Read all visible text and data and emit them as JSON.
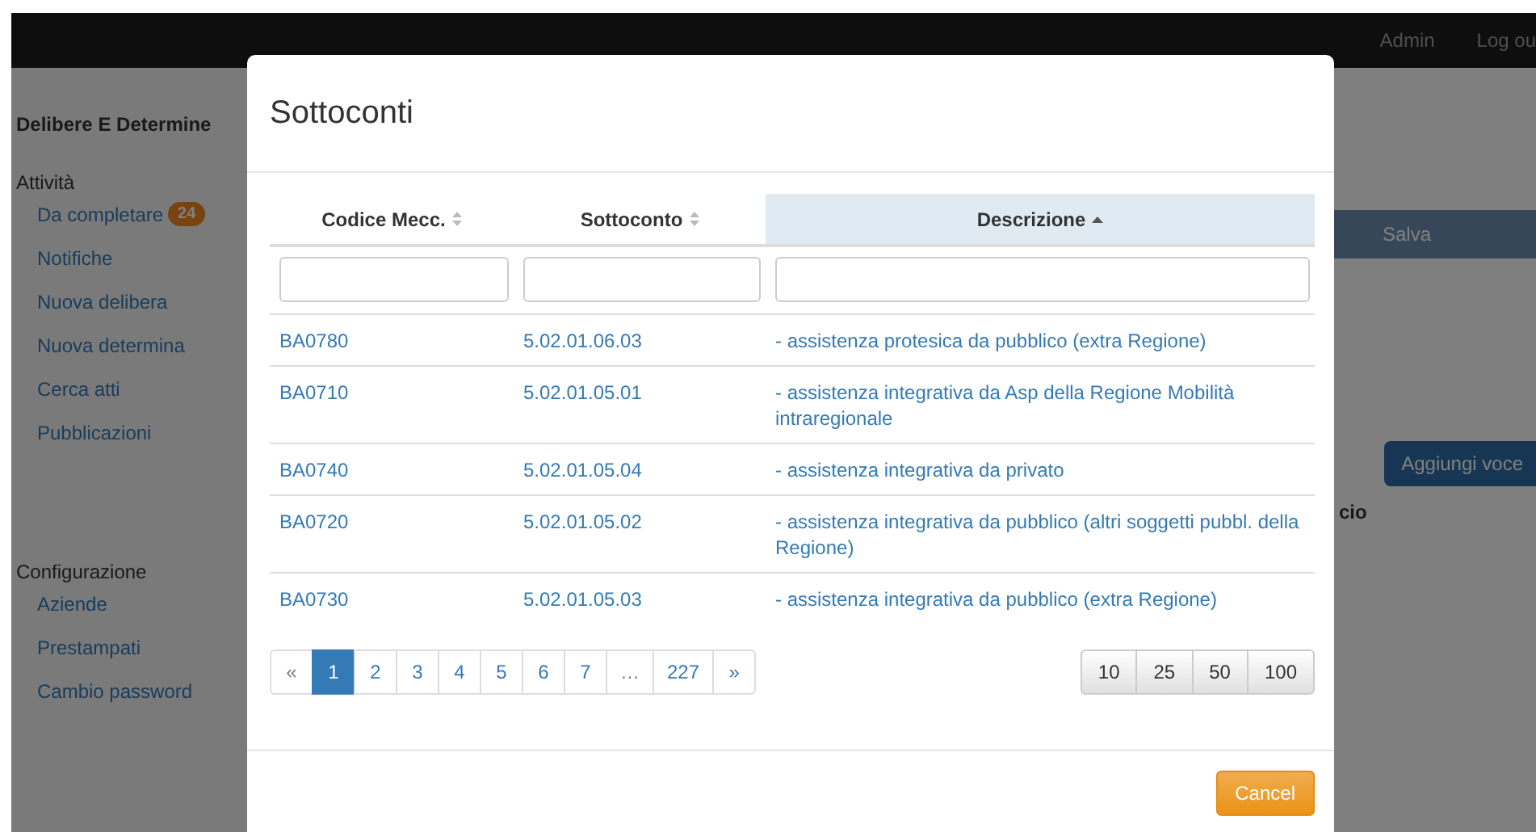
{
  "navbar": {
    "links": [
      "Admin",
      "Log ou"
    ]
  },
  "sidebar": {
    "title": "Delibere E Determine",
    "sections": [
      {
        "heading": "Attività",
        "items": [
          {
            "label": "Da completare",
            "badge": "24"
          },
          {
            "label": "Notifiche"
          },
          {
            "label": "Nuova delibera"
          },
          {
            "label": "Nuova determina"
          },
          {
            "label": "Cerca atti"
          },
          {
            "label": "Pubblicazioni"
          }
        ]
      },
      {
        "heading": "Configurazione",
        "items": [
          {
            "label": "Aziende"
          },
          {
            "label": "Prestampati"
          },
          {
            "label": "Cambio password"
          }
        ]
      }
    ]
  },
  "background": {
    "save_button": "Salva",
    "add_button": "Aggiungi voce",
    "column_fragment": "cio"
  },
  "modal": {
    "title": "Sottoconti",
    "columns": [
      {
        "label": "Codice Mecc.",
        "sorted": false
      },
      {
        "label": "Sottoconto",
        "sorted": false
      },
      {
        "label": "Descrizione",
        "sorted": true
      }
    ],
    "rows": [
      {
        "code": "BA0780",
        "account": "5.02.01.06.03",
        "description": "- assistenza protesica da pubblico (extra Regione)"
      },
      {
        "code": "BA0710",
        "account": "5.02.01.05.01",
        "description": "- assistenza integrativa da Asp della Regione Mobilità intraregionale"
      },
      {
        "code": "BA0740",
        "account": "5.02.01.05.04",
        "description": "- assistenza integrativa da privato"
      },
      {
        "code": "BA0720",
        "account": "5.02.01.05.02",
        "description": "- assistenza integrativa da pubblico (altri soggetti pubbl. della Regione)"
      },
      {
        "code": "BA0730",
        "account": "5.02.01.05.03",
        "description": "- assistenza integrativa da pubblico (extra Regione)"
      }
    ],
    "pagination": [
      {
        "label": "«",
        "selected": false,
        "disabled": true
      },
      {
        "label": "1",
        "selected": true,
        "disabled": false
      },
      {
        "label": "2",
        "selected": false,
        "disabled": false
      },
      {
        "label": "3",
        "selected": false,
        "disabled": false
      },
      {
        "label": "4",
        "selected": false,
        "disabled": false
      },
      {
        "label": "5",
        "selected": false,
        "disabled": false
      },
      {
        "label": "6",
        "selected": false,
        "disabled": false
      },
      {
        "label": "7",
        "selected": false,
        "disabled": false
      },
      {
        "label": "…",
        "selected": false,
        "disabled": true
      },
      {
        "label": "227",
        "selected": false,
        "disabled": false
      },
      {
        "label": "»",
        "selected": false,
        "disabled": false
      }
    ],
    "page_sizes": [
      "10",
      "25",
      "50",
      "100"
    ],
    "cancel_button": "Cancel"
  }
}
